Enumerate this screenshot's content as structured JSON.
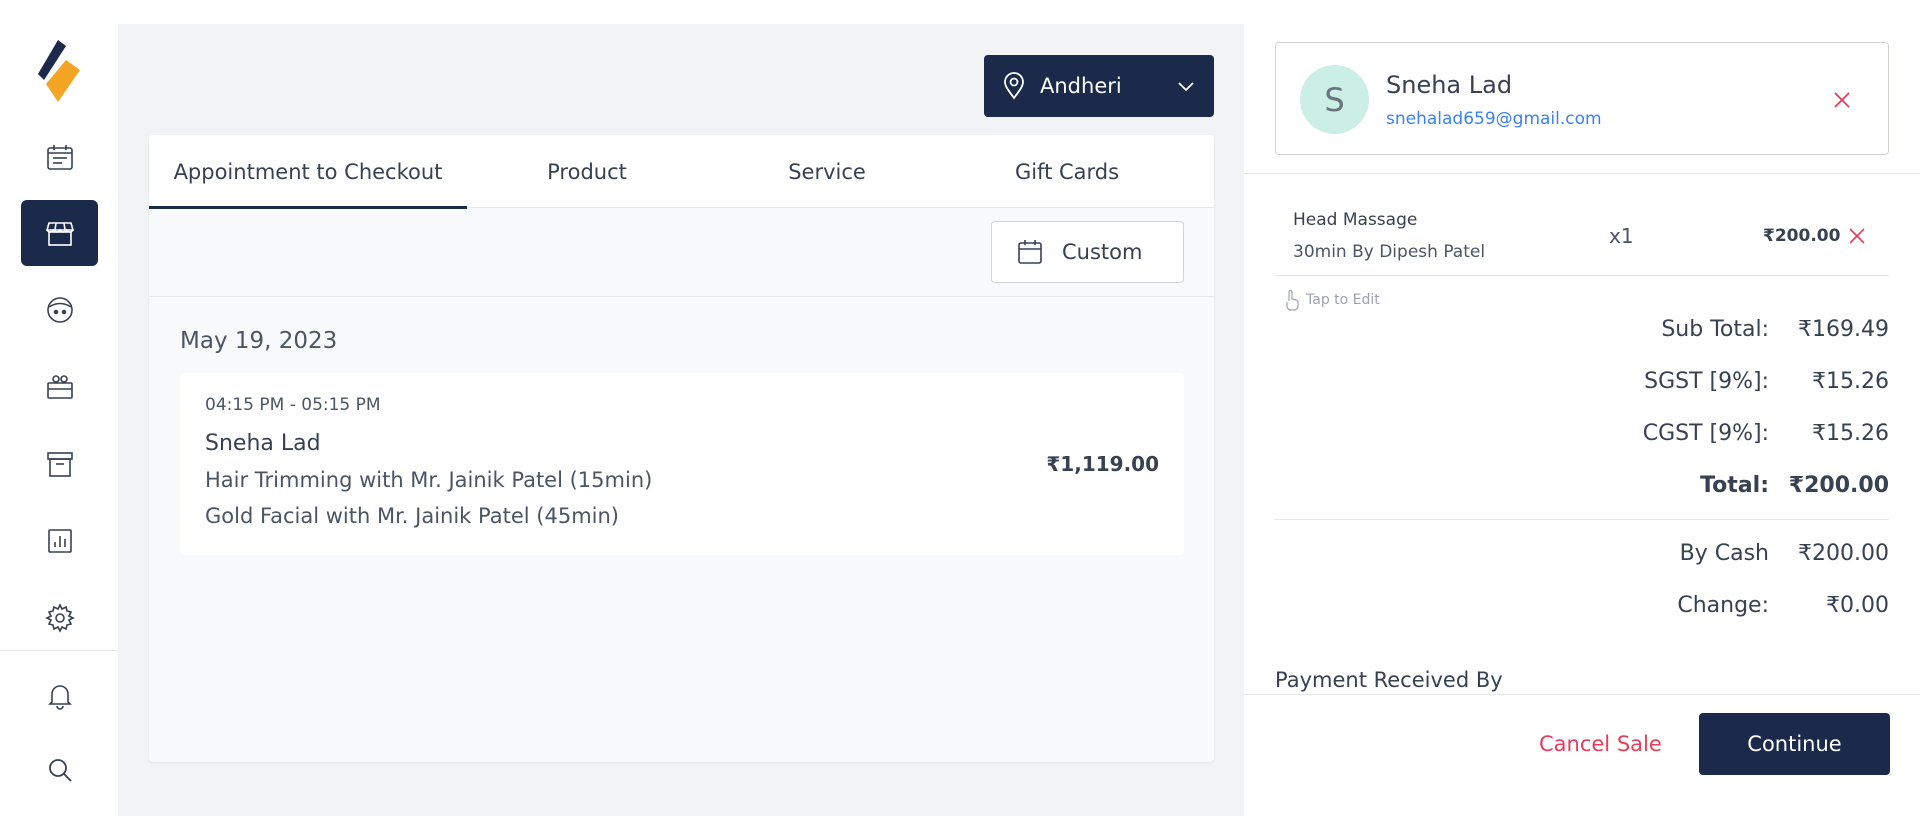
{
  "sidebar": {
    "items": [
      {
        "name": "calendar"
      },
      {
        "name": "store",
        "active": true
      },
      {
        "name": "face"
      },
      {
        "name": "gift"
      },
      {
        "name": "archive"
      },
      {
        "name": "reports"
      },
      {
        "name": "settings"
      },
      {
        "name": "notifications"
      },
      {
        "name": "search"
      }
    ],
    "accent_color": "#1b2a4a"
  },
  "location": {
    "label": "Andheri"
  },
  "tabs": [
    {
      "label": "Appointment to Checkout",
      "active": true
    },
    {
      "label": "Product"
    },
    {
      "label": "Service"
    },
    {
      "label": "Gift Cards"
    }
  ],
  "filter": {
    "custom_label": "Custom"
  },
  "appointments": {
    "date": "May 19, 2023",
    "items": [
      {
        "time": "04:15 PM - 05:15 PM",
        "client": "Sneha Lad",
        "lines": [
          "Hair Trimming with Mr. Jainik Patel (15min)",
          "Gold Facial with Mr. Jainik Patel (45min)"
        ],
        "price": "₹1,119.00"
      }
    ]
  },
  "client": {
    "initial": "S",
    "name": "Sneha Lad",
    "email": "snehalad659@gmail.com",
    "avatar_color": "#ccefe5"
  },
  "cart": {
    "items": [
      {
        "name": "Head Massage",
        "detail": "30min By Dipesh Patel",
        "qty": "x1",
        "price": "₹200.00"
      }
    ],
    "tap_to_edit": "Tap to Edit"
  },
  "summary": {
    "subtotal_label": "Sub Total:",
    "subtotal": "₹169.49",
    "sgst_label": "SGST [9%]:",
    "sgst": "₹15.26",
    "cgst_label": "CGST [9%]:",
    "cgst": "₹15.26",
    "total_label": "Total:",
    "total": "₹200.00",
    "by_cash_label": "By Cash",
    "by_cash": "₹200.00",
    "change_label": "Change:",
    "change": "₹0.00"
  },
  "payment": {
    "received_by_label": "Payment Received By"
  },
  "actions": {
    "cancel_label": "Cancel Sale",
    "continue_label": "Continue",
    "cancel_color": "#e53e5a"
  }
}
